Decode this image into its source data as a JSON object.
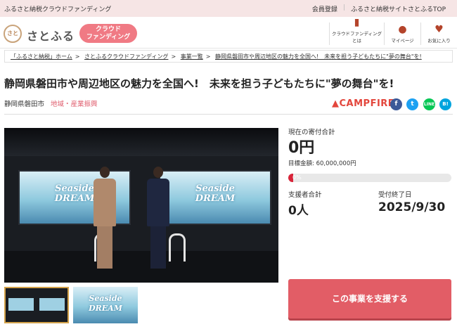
{
  "topbar": {
    "left_text": "ふるさと納税クラウドファンディング",
    "member_register": "会員登録",
    "site_top": "ふるさと納税サイトさとふるTOP"
  },
  "header": {
    "logo_mark": "さと",
    "logo_text": "さとふる",
    "cf_badge_line1": "クラウド",
    "cf_badge_line2": "ファンディング",
    "nav": [
      {
        "label": "クラウドファンディングとは",
        "icon": "book-icon"
      },
      {
        "label": "マイページ",
        "icon": "person-icon"
      },
      {
        "label": "お気に入り",
        "icon": "heart-icon"
      }
    ]
  },
  "breadcrumb": [
    "「ふるさと納税」ホーム",
    "さとふるクラウドファンディング",
    "事業一覧",
    "静岡県磐田市や周辺地区の魅力を全国へ!　未来を担う子どもたちに\"夢の舞台\"を!"
  ],
  "project": {
    "title": "静岡県磐田市や周辺地区の魅力を全国へ!　未来を担う子どもたちに\"夢の舞台\"を!",
    "location": "静岡県磐田市",
    "category": "地域・産業振興",
    "platform": "CAMPFIRE",
    "screen_text_1": "Seaside",
    "screen_text_2": "DREAM"
  },
  "share": {
    "facebook": "f",
    "twitter": "t",
    "line": "LINE",
    "hatena": "B!"
  },
  "stats": {
    "current_label": "現在の寄付合計",
    "current_amount": "0円",
    "target": "目標金額: 60,000,000円",
    "progress_text": "0%",
    "progress_fraction": 0.03,
    "supporters_label": "支援者合計",
    "supporters": "0人",
    "deadline_label": "受付終了日",
    "deadline": "2025/9/30"
  },
  "cta": {
    "support_label": "この事業を支援する"
  },
  "colors": {
    "accent": "#e25d66",
    "topbar_bg": "#f6e5e5",
    "progress": "#d8253a"
  }
}
